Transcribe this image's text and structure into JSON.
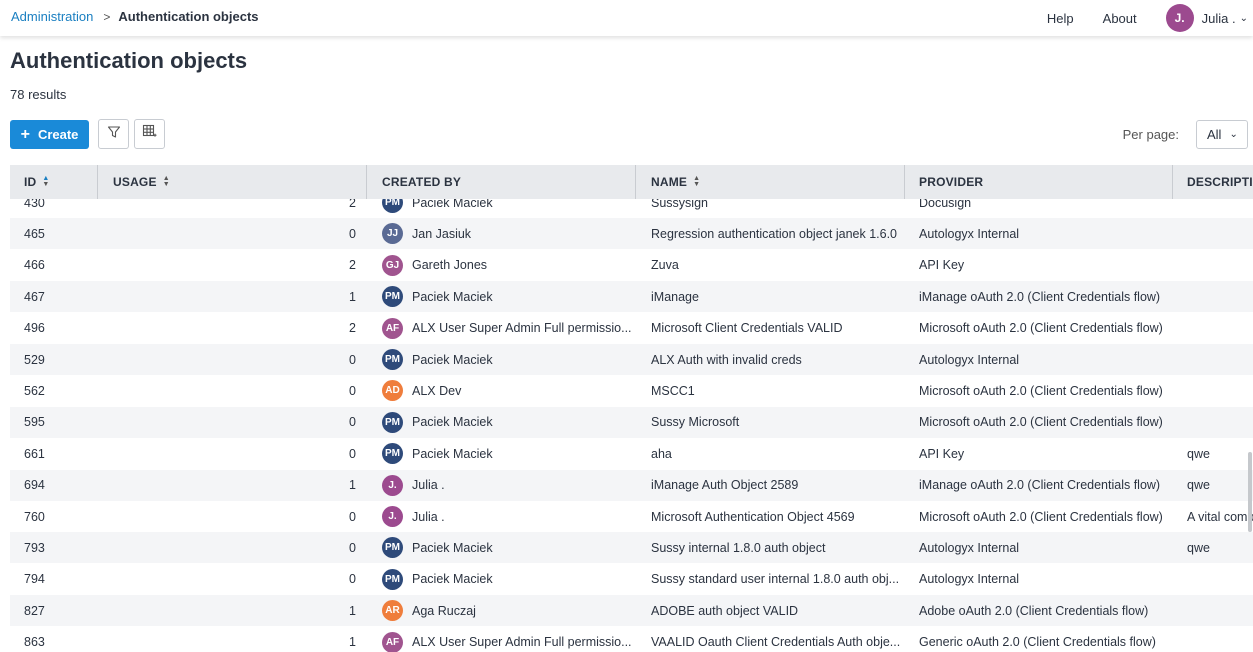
{
  "breadcrumb": {
    "parent": "Administration",
    "separator": ">",
    "current": "Authentication objects"
  },
  "topnav": {
    "help": "Help",
    "about": "About",
    "user_initials": "J.",
    "user_name": "Julia ."
  },
  "page": {
    "title": "Authentication objects",
    "results": "78 results"
  },
  "toolbar": {
    "create_label": "Create",
    "per_page_label": "Per page:",
    "per_page_value": "All"
  },
  "table": {
    "columns": [
      "ID",
      "USAGE",
      "CREATED BY",
      "NAME",
      "PROVIDER",
      "DESCRIPTIO"
    ],
    "rows": [
      {
        "id": "430",
        "usage": "2",
        "initials": "PM",
        "color": "#2e4a7a",
        "created_by": "Paciek Maciek",
        "name": "Sussysign",
        "provider": "Docusign",
        "description": ""
      },
      {
        "id": "465",
        "usage": "0",
        "initials": "JJ",
        "color": "#5a6a94",
        "created_by": "Jan Jasiuk",
        "name": "Regression authentication object janek 1.6.0",
        "provider": "Autologyx Internal",
        "description": ""
      },
      {
        "id": "466",
        "usage": "2",
        "initials": "GJ",
        "color": "#a0548f",
        "created_by": "Gareth Jones",
        "name": "Zuva",
        "provider": "API Key",
        "description": ""
      },
      {
        "id": "467",
        "usage": "1",
        "initials": "PM",
        "color": "#2e4a7a",
        "created_by": "Paciek Maciek",
        "name": "iManage",
        "provider": "iManage oAuth 2.0 (Client Credentials flow)",
        "description": ""
      },
      {
        "id": "496",
        "usage": "2",
        "initials": "AF",
        "color": "#a0548f",
        "created_by": "ALX User Super Admin Full permissio...",
        "name": "Microsoft Client Credentials VALID",
        "provider": "Microsoft oAuth 2.0 (Client Credentials flow)",
        "description": ""
      },
      {
        "id": "529",
        "usage": "0",
        "initials": "PM",
        "color": "#2e4a7a",
        "created_by": "Paciek Maciek",
        "name": "ALX Auth with invalid creds",
        "provider": "Autologyx Internal",
        "description": ""
      },
      {
        "id": "562",
        "usage": "0",
        "initials": "AD",
        "color": "#ef7d3c",
        "created_by": "ALX Dev",
        "name": "MSCC1",
        "provider": "Microsoft oAuth 2.0 (Client Credentials flow)",
        "description": ""
      },
      {
        "id": "595",
        "usage": "0",
        "initials": "PM",
        "color": "#2e4a7a",
        "created_by": "Paciek Maciek",
        "name": "Sussy Microsoft",
        "provider": "Microsoft oAuth 2.0 (Client Credentials flow)",
        "description": ""
      },
      {
        "id": "661",
        "usage": "0",
        "initials": "PM",
        "color": "#2e4a7a",
        "created_by": "Paciek Maciek",
        "name": "aha",
        "provider": "API Key",
        "description": "qwe"
      },
      {
        "id": "694",
        "usage": "1",
        "initials": "J.",
        "color": "#9c4a8f",
        "created_by": "Julia .",
        "name": "iManage Auth Object 2589",
        "provider": "iManage oAuth 2.0 (Client Credentials flow)",
        "description": "qwe"
      },
      {
        "id": "760",
        "usage": "0",
        "initials": "J.",
        "color": "#9c4a8f",
        "created_by": "Julia .",
        "name": "Microsoft Authentication Object 4569",
        "provider": "Microsoft oAuth 2.0 (Client Credentials flow)",
        "description": "A vital comp"
      },
      {
        "id": "793",
        "usage": "0",
        "initials": "PM",
        "color": "#2e4a7a",
        "created_by": "Paciek Maciek",
        "name": "Sussy internal 1.8.0 auth object",
        "provider": "Autologyx Internal",
        "description": "qwe"
      },
      {
        "id": "794",
        "usage": "0",
        "initials": "PM",
        "color": "#2e4a7a",
        "created_by": "Paciek Maciek",
        "name": "Sussy standard user internal 1.8.0 auth obj...",
        "provider": "Autologyx Internal",
        "description": ""
      },
      {
        "id": "827",
        "usage": "1",
        "initials": "AR",
        "color": "#ef7d3c",
        "created_by": "Aga Ruczaj",
        "name": "ADOBE auth object VALID",
        "provider": "Adobe oAuth 2.0 (Client Credentials flow)",
        "description": ""
      },
      {
        "id": "863",
        "usage": "1",
        "initials": "AF",
        "color": "#a0548f",
        "created_by": "ALX User Super Admin Full permissio...",
        "name": "VAALID Oauth Client Credentials Auth obje...",
        "provider": "Generic oAuth 2.0 (Client Credentials flow)",
        "description": ""
      }
    ]
  }
}
